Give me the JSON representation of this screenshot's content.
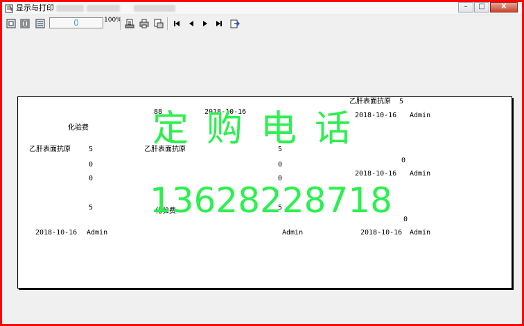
{
  "window": {
    "title": "显示与打印",
    "controls": {
      "minimize": "–",
      "maximize": "□",
      "close": "X"
    }
  },
  "toolbar": {
    "zoom_value": "0",
    "zoom_percent": "100%",
    "icons": [
      "fit-page-icon",
      "two-page-icon",
      "multi-page-icon",
      "page-setup-icon",
      "print-icon",
      "print-preview-icon",
      "first-page-icon",
      "prev-page-icon",
      "next-page-icon",
      "last-page-icon",
      "export-icon"
    ]
  },
  "report": {
    "cells": [
      {
        "name": "t1",
        "text": "乙肝表面抗原"
      },
      {
        "name": "t2",
        "text": "5"
      },
      {
        "name": "t3",
        "text": "88"
      },
      {
        "name": "t4",
        "text": "2018-10-16"
      },
      {
        "name": "t5",
        "text": "2018-10-16"
      },
      {
        "name": "t6",
        "text": "Admin"
      },
      {
        "name": "t7",
        "text": "化验费"
      },
      {
        "name": "t8",
        "text": "乙肝表面抗原"
      },
      {
        "name": "t9",
        "text": "5"
      },
      {
        "name": "t10",
        "text": "乙肝表面抗原"
      },
      {
        "name": "t11",
        "text": "5"
      },
      {
        "name": "t12",
        "text": "0"
      },
      {
        "name": "t13",
        "text": "0"
      },
      {
        "name": "t14",
        "text": "0"
      },
      {
        "name": "t15",
        "text": "2018-10-16"
      },
      {
        "name": "t16",
        "text": "Admin"
      },
      {
        "name": "t17",
        "text": "0"
      },
      {
        "name": "t18",
        "text": "0"
      },
      {
        "name": "t19",
        "text": "5"
      },
      {
        "name": "t20",
        "text": "化验费"
      },
      {
        "name": "t21",
        "text": "5"
      },
      {
        "name": "t22",
        "text": "0"
      },
      {
        "name": "t23",
        "text": "2018-10-16"
      },
      {
        "name": "t24",
        "text": "Admin"
      },
      {
        "name": "t25",
        "text": "Admin"
      },
      {
        "name": "t26",
        "text": "2018-10-16"
      },
      {
        "name": "t27",
        "text": "Admin"
      }
    ],
    "watermark_line1": "定购电话",
    "watermark_line2": "13628228718"
  },
  "colors": {
    "frame": "#ff0000",
    "watermark": "#2cf04f",
    "zoom_text": "#4aa3df"
  }
}
